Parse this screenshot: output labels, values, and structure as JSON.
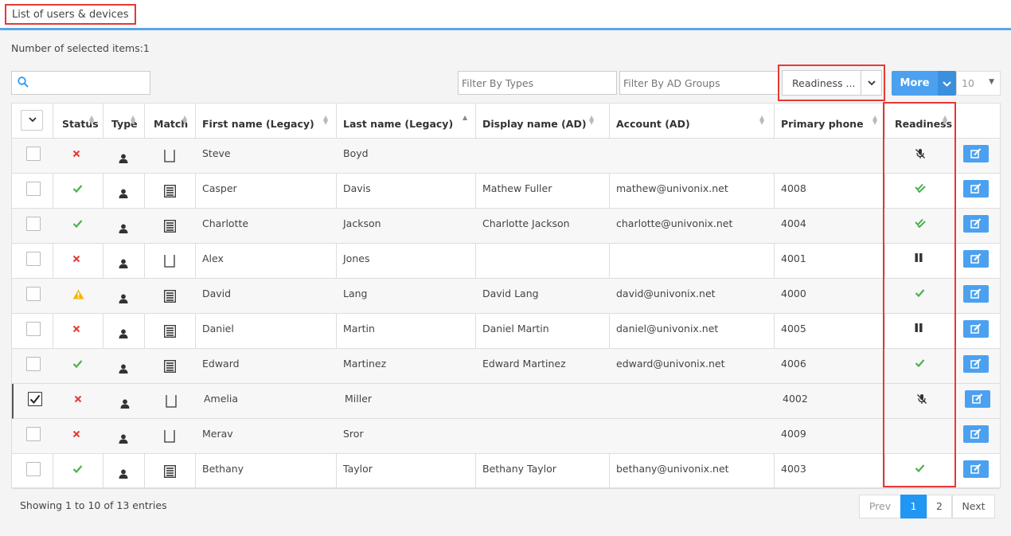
{
  "page": {
    "title": "List of users & devices",
    "selected_count": "Number of selected items:1"
  },
  "toolbar": {
    "search_placeholder": "",
    "filter_types_placeholder": "Filter By Types",
    "filter_groups_placeholder": "Filter By AD Groups",
    "readiness_filter": "Readiness ...",
    "more_label": "More",
    "page_size": "10"
  },
  "table": {
    "columns": [
      "Status",
      "Type",
      "Match",
      "First name (Legacy)",
      "Last name (Legacy)",
      "Display name (AD)",
      "Account (AD)",
      "Primary phone",
      "Readiness"
    ],
    "rows": [
      {
        "checked": false,
        "status": "x",
        "match": "empty",
        "first": "Steve",
        "last": "Boyd",
        "display": "",
        "account": "",
        "phone": "",
        "readiness": "no-mic"
      },
      {
        "checked": false,
        "status": "check",
        "match": "list",
        "first": "Casper",
        "last": "Davis",
        "display": "Mathew Fuller",
        "account": "mathew@univonix.net",
        "phone": "4008",
        "readiness": "double-check"
      },
      {
        "checked": false,
        "status": "check",
        "match": "list",
        "first": "Charlotte",
        "last": "Jackson",
        "display": "Charlotte Jackson",
        "account": "charlotte@univonix.net",
        "phone": "4004",
        "readiness": "double-check"
      },
      {
        "checked": false,
        "status": "x",
        "match": "empty",
        "first": "Alex",
        "last": "Jones",
        "display": "",
        "account": "",
        "phone": "4001",
        "readiness": "pause"
      },
      {
        "checked": false,
        "status": "warning",
        "match": "list",
        "first": "David",
        "last": "Lang",
        "display": "David Lang",
        "account": "david@univonix.net",
        "phone": "4000",
        "readiness": "check"
      },
      {
        "checked": false,
        "status": "x",
        "match": "list",
        "first": "Daniel",
        "last": "Martin",
        "display": "Daniel Martin",
        "account": "daniel@univonix.net",
        "phone": "4005",
        "readiness": "pause"
      },
      {
        "checked": false,
        "status": "check",
        "match": "list",
        "first": "Edward",
        "last": "Martinez",
        "display": "Edward Martinez",
        "account": "edward@univonix.net",
        "phone": "4006",
        "readiness": "check"
      },
      {
        "checked": true,
        "status": "x",
        "match": "empty",
        "first": "Amelia",
        "last": "Miller",
        "display": "",
        "account": "",
        "phone": "4002",
        "readiness": "no-mic"
      },
      {
        "checked": false,
        "status": "x",
        "match": "empty",
        "first": "Merav",
        "last": "Sror",
        "display": "",
        "account": "",
        "phone": "4009",
        "readiness": "none"
      },
      {
        "checked": false,
        "status": "check",
        "match": "list",
        "first": "Bethany",
        "last": "Taylor",
        "display": "Bethany Taylor",
        "account": "bethany@univonix.net",
        "phone": "4003",
        "readiness": "check"
      }
    ]
  },
  "footer": {
    "info": "Showing 1 to 10 of 13 entries",
    "prev": "Prev",
    "page1": "1",
    "page2": "2",
    "next": "Next"
  },
  "colors": {
    "accent": "#4ba1f0",
    "green": "#4caf50",
    "red": "#e53935",
    "warning": "#f5b800",
    "highlight": "#e53935"
  }
}
